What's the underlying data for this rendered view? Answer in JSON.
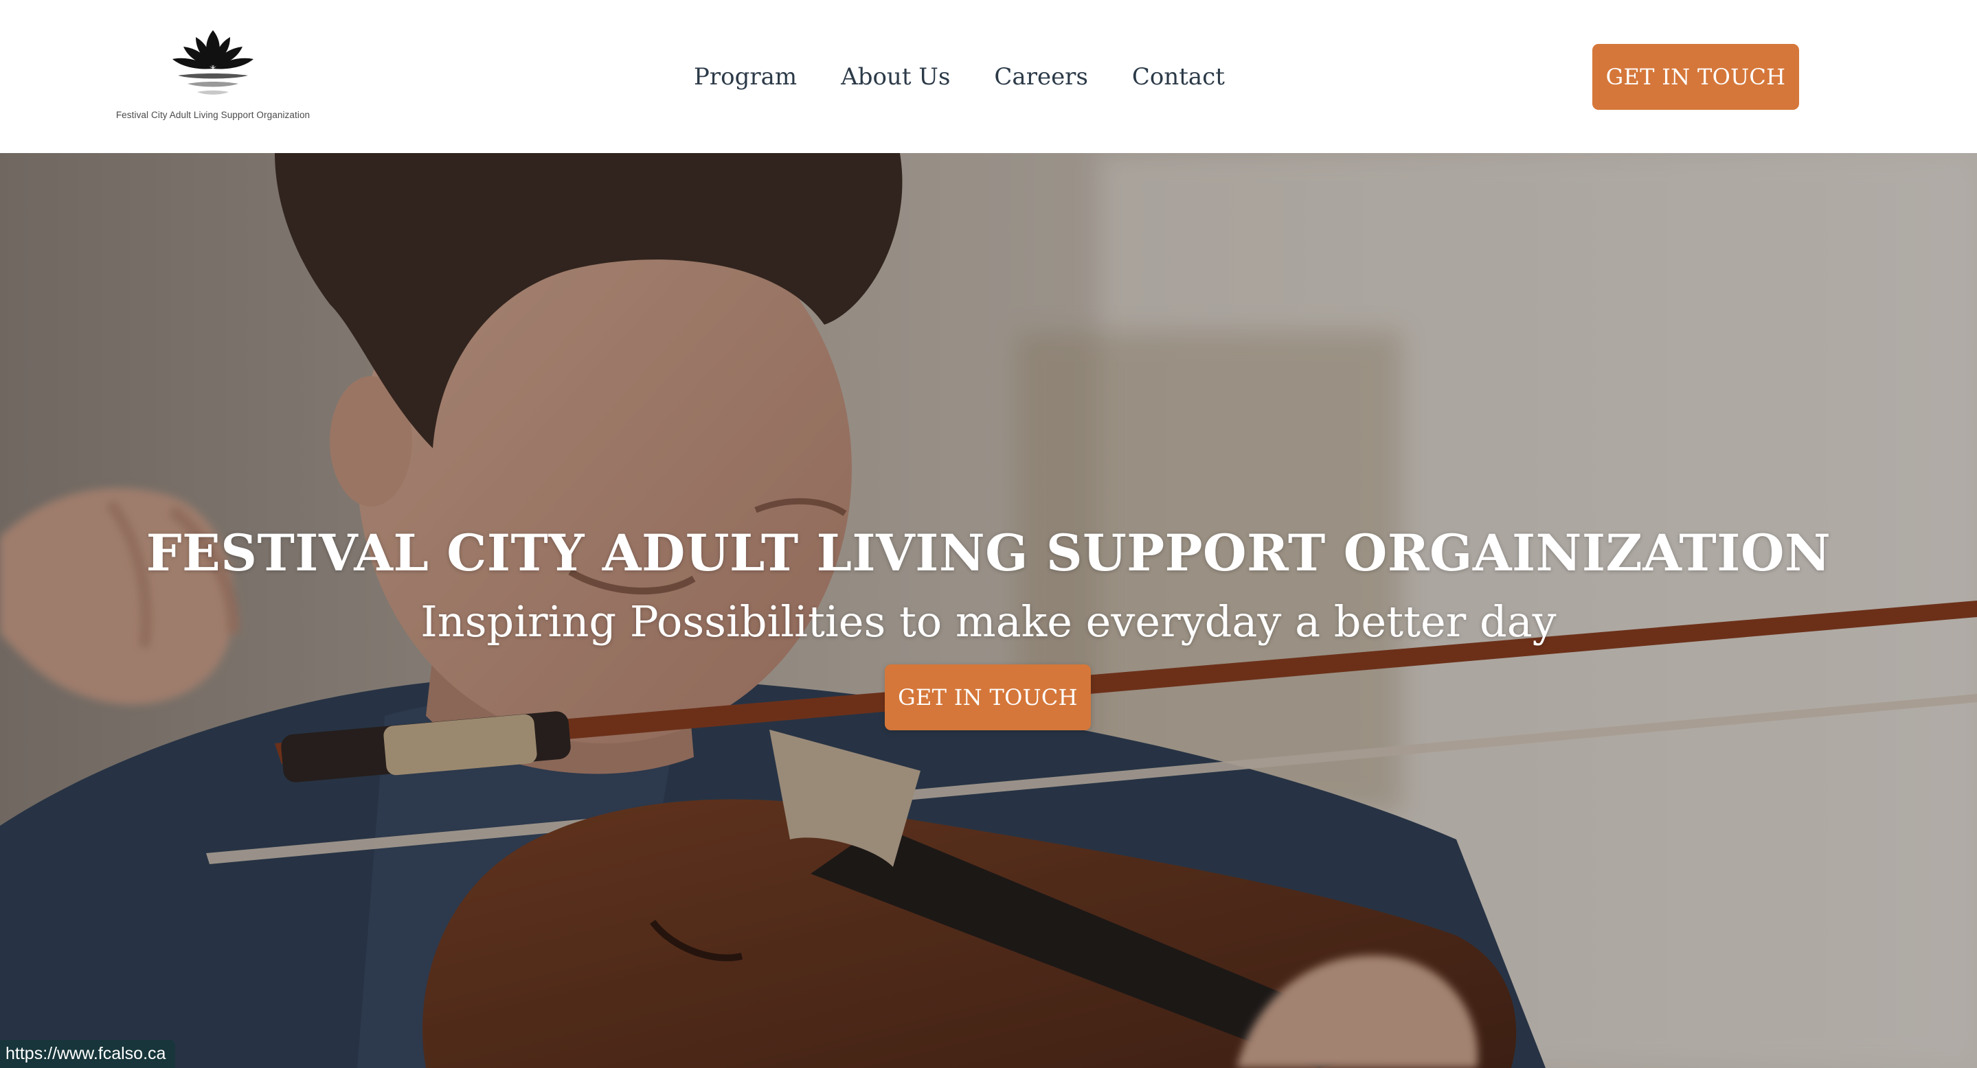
{
  "header": {
    "logo": {
      "icon": "lotus-logo-icon",
      "text": "Festival City Adult Living Support Organization"
    },
    "nav": [
      {
        "label": "Program"
      },
      {
        "label": "About Us"
      },
      {
        "label": "Careers"
      },
      {
        "label": "Contact"
      }
    ],
    "cta_label": "GET IN TOUCH"
  },
  "hero": {
    "image": "man-playing-violin-photo",
    "title": "FESTIVAL CITY ADULT LIVING SUPPORT ORGAINIZATION",
    "subtitle": "Inspiring Possibilities to make everyday a better day",
    "cta_label": "GET IN TOUCH"
  },
  "status_bar": {
    "url": "https://www.fcalso.ca"
  },
  "colors": {
    "accent": "#d5773a",
    "nav_text": "#2c3a48",
    "header_bg": "#ffffff",
    "status_bar_bg": "#17353a"
  }
}
